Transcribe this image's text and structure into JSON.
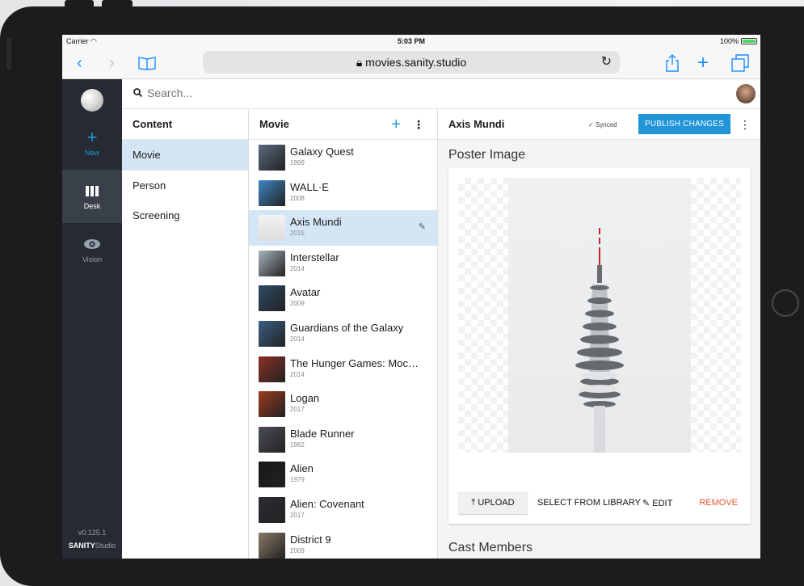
{
  "statusbar": {
    "carrier": "Carrier",
    "time": "5:03 PM",
    "battery": "100%"
  },
  "safari": {
    "url": "movies.sanity.studio"
  },
  "sidebar": {
    "items": [
      {
        "label": "New",
        "icon": "plus-icon"
      },
      {
        "label": "Desk",
        "icon": "columns-icon"
      },
      {
        "label": "Vision",
        "icon": "eye-icon"
      }
    ],
    "version": "v0.125.1",
    "brand_bold": "SANITY",
    "brand_rest": "Studio"
  },
  "search": {
    "placeholder": "Search..."
  },
  "content": {
    "title": "Content",
    "items": [
      "Movie",
      "Person",
      "Screening"
    ]
  },
  "movies": {
    "title": "Movie",
    "items": [
      {
        "title": "Galaxy Quest",
        "year": "1999",
        "color": "#5a6a7f"
      },
      {
        "title": "WALL·E",
        "year": "2008",
        "color": "#3f86c6"
      },
      {
        "title": "Axis Mundi",
        "year": "2015",
        "color": "#e8e8e8"
      },
      {
        "title": "Interstellar",
        "year": "2014",
        "color": "#a6b3bd"
      },
      {
        "title": "Avatar",
        "year": "2009",
        "color": "#2e4a66"
      },
      {
        "title": "Guardians of the Galaxy",
        "year": "2014",
        "color": "#3a5f86"
      },
      {
        "title": "The Hunger Games: Mockingjay",
        "year": "2014",
        "color": "#8c2f24"
      },
      {
        "title": "Logan",
        "year": "2017",
        "color": "#9c3a1c"
      },
      {
        "title": "Blade Runner",
        "year": "1982",
        "color": "#4b4e57"
      },
      {
        "title": "Alien",
        "year": "1979",
        "color": "#171717"
      },
      {
        "title": "Alien: Covenant",
        "year": "2017",
        "color": "#2a2d33"
      },
      {
        "title": "District 9",
        "year": "2009",
        "color": "#8a7a66"
      }
    ]
  },
  "document": {
    "title": "Axis Mundi",
    "synced": "Synced",
    "publish": "PUBLISH CHANGES",
    "poster_label": "Poster Image",
    "cast_label": "Cast Members",
    "actions": {
      "upload": "UPLOAD",
      "library": "SELECT FROM LIBRARY",
      "edit": "EDIT",
      "remove": "REMOVE"
    }
  },
  "colors": {
    "accent": "#2294d8",
    "sidebar": "#262b33",
    "selected": "#d4e6f5",
    "remove": "#e0582e"
  }
}
